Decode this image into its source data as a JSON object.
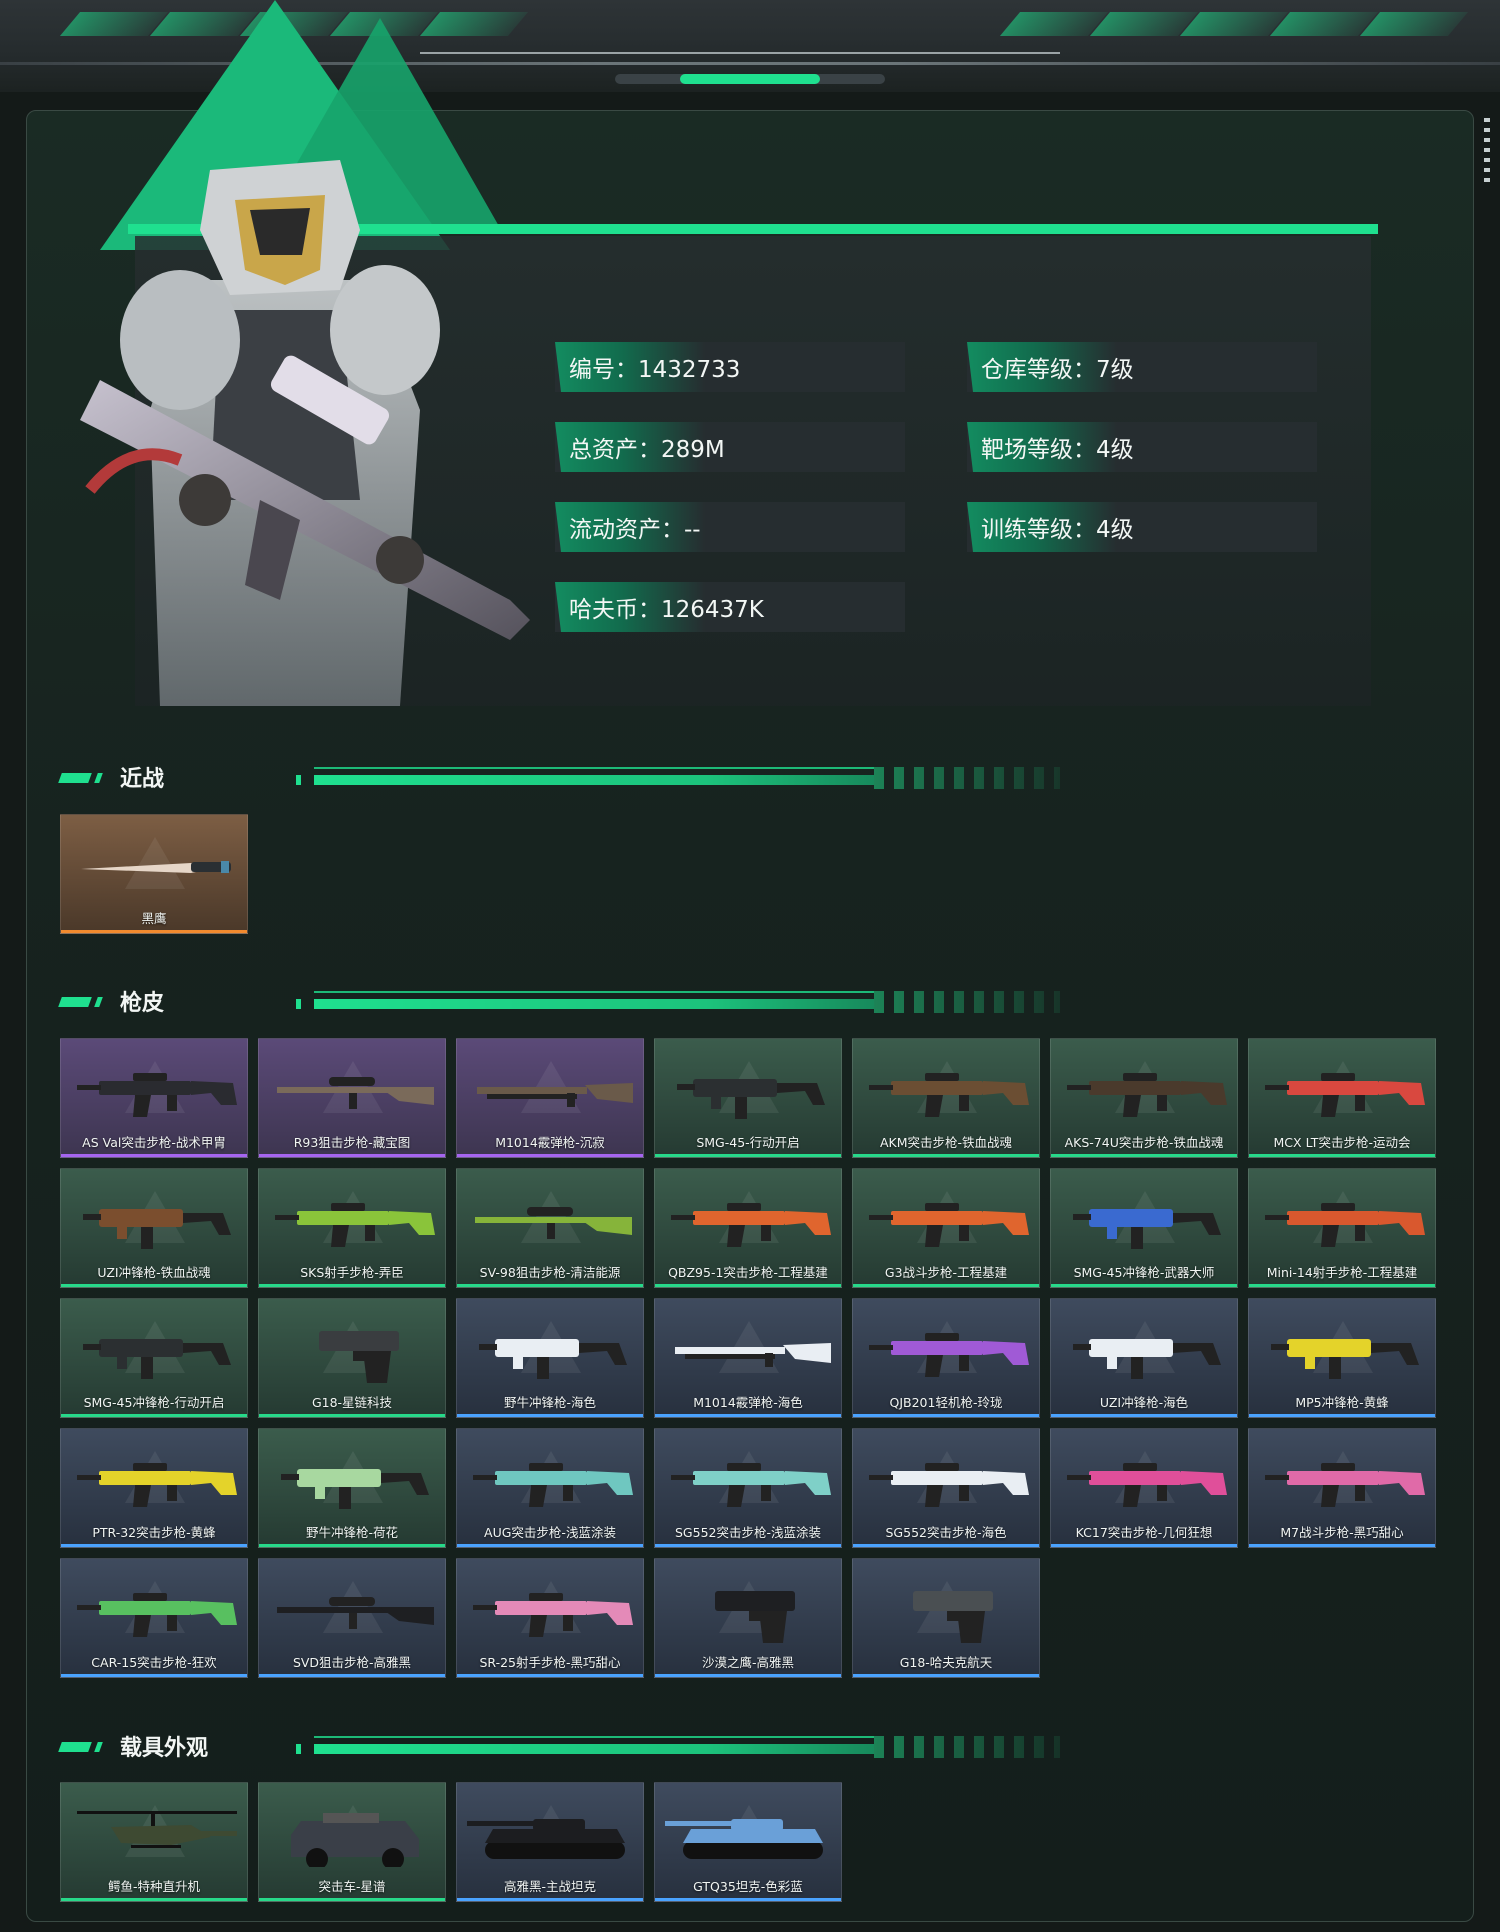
{
  "profile": {
    "stats_left": [
      "编号：1432733",
      "总资产：289M",
      "流动资产：--",
      "哈夫币：126437K"
    ],
    "stats_right": [
      "仓库等级：7级",
      "靶场等级：4级",
      "训练等级：4级"
    ]
  },
  "sections": {
    "melee": {
      "title": "近战",
      "items": [
        {
          "name": "黑鹰",
          "rarity": "orange",
          "icon": "knife-icon"
        }
      ]
    },
    "skins": {
      "title": "枪皮",
      "items": [
        {
          "name": "AS Val突击步枪-战术甲胄",
          "rarity": "purple",
          "icon": "rifle-icon",
          "color": "#2a2b30"
        },
        {
          "name": "R93狙击步枪-藏宝图",
          "rarity": "purple",
          "icon": "sniper-icon",
          "color": "#7a6a5a"
        },
        {
          "name": "M1014霰弹枪-沉寂",
          "rarity": "purple",
          "icon": "shotgun-icon",
          "color": "#6a5a4a"
        },
        {
          "name": "SMG-45-行动开启",
          "rarity": "green",
          "icon": "smg-icon",
          "color": "#2b2f31"
        },
        {
          "name": "AKM突击步枪-铁血战魂",
          "rarity": "green",
          "icon": "rifle-icon",
          "color": "#6b4e33"
        },
        {
          "name": "AKS-74U突击步枪-铁血战魂",
          "rarity": "green",
          "icon": "rifle-icon",
          "color": "#4a3a2c"
        },
        {
          "name": "MCX LT突击步枪-运动会",
          "rarity": "green",
          "icon": "rifle-icon",
          "color": "#d9483f"
        },
        {
          "name": "UZI冲锋枪-铁血战魂",
          "rarity": "green",
          "icon": "smg-icon",
          "color": "#7b4e2e"
        },
        {
          "name": "SKS射手步枪-弄臣",
          "rarity": "green",
          "icon": "rifle-icon",
          "color": "#8ac43a"
        },
        {
          "name": "SV-98狙击步枪-清洁能源",
          "rarity": "green",
          "icon": "sniper-icon",
          "color": "#86b43a"
        },
        {
          "name": "QBZ95-1突击步枪-工程基建",
          "rarity": "green",
          "icon": "rifle-icon",
          "color": "#e0652e"
        },
        {
          "name": "G3战斗步枪-工程基建",
          "rarity": "green",
          "icon": "rifle-icon",
          "color": "#e0652e"
        },
        {
          "name": "SMG-45冲锋枪-武器大师",
          "rarity": "green",
          "icon": "smg-icon",
          "color": "#3a6ad0"
        },
        {
          "name": "Mini-14射手步枪-工程基建",
          "rarity": "green",
          "icon": "rifle-icon",
          "color": "#d9582e"
        },
        {
          "name": "SMG-45冲锋枪-行动开启",
          "rarity": "green",
          "icon": "smg-icon",
          "color": "#2b2f31"
        },
        {
          "name": "G18-星链科技",
          "rarity": "green",
          "icon": "pistol-icon",
          "color": "#3a3d40"
        },
        {
          "name": "野牛冲锋枪-海色",
          "rarity": "blue",
          "icon": "smg-icon",
          "color": "#e9eef3"
        },
        {
          "name": "M1014霰弹枪-海色",
          "rarity": "blue",
          "icon": "shotgun-icon",
          "color": "#e9eef3"
        },
        {
          "name": "QJB201轻机枪-玲珑",
          "rarity": "blue",
          "icon": "rifle-icon",
          "color": "#a05ad6"
        },
        {
          "name": "UZI冲锋枪-海色",
          "rarity": "blue",
          "icon": "smg-icon",
          "color": "#e9eef3"
        },
        {
          "name": "MP5冲锋枪-黄蜂",
          "rarity": "blue",
          "icon": "smg-icon",
          "color": "#e4d32a"
        },
        {
          "name": "PTR-32突击步枪-黄蜂",
          "rarity": "blue",
          "icon": "rifle-icon",
          "color": "#e4d32a"
        },
        {
          "name": "野牛冲锋枪-荷花",
          "rarity": "green",
          "icon": "smg-icon",
          "color": "#a8d8a0"
        },
        {
          "name": "AUG突击步枪-浅蓝涂装",
          "rarity": "blue",
          "icon": "rifle-icon",
          "color": "#6fc7c0"
        },
        {
          "name": "SG552突击步枪-浅蓝涂装",
          "rarity": "blue",
          "icon": "rifle-icon",
          "color": "#7fd0c8"
        },
        {
          "name": "SG552突击步枪-海色",
          "rarity": "blue",
          "icon": "rifle-icon",
          "color": "#e9eef3"
        },
        {
          "name": "KC17突击步枪-几何狂想",
          "rarity": "blue",
          "icon": "rifle-icon",
          "color": "#e04f9a"
        },
        {
          "name": "M7战斗步枪-黑巧甜心",
          "rarity": "blue",
          "icon": "rifle-icon",
          "color": "#e06aa8"
        },
        {
          "name": "CAR-15突击步枪-狂欢",
          "rarity": "blue",
          "icon": "rifle-icon",
          "color": "#58c060"
        },
        {
          "name": "SVD狙击步枪-高雅黑",
          "rarity": "blue",
          "icon": "sniper-icon",
          "color": "#1e1f22"
        },
        {
          "name": "SR-25射手步枪-黑巧甜心",
          "rarity": "blue",
          "icon": "rifle-icon",
          "color": "#e48ab8"
        },
        {
          "name": "沙漠之鹰-高雅黑",
          "rarity": "blue",
          "icon": "pistol-icon",
          "color": "#1e1f22"
        },
        {
          "name": "G18-哈夫克航天",
          "rarity": "blue",
          "icon": "pistol-icon",
          "color": "#4a4f52"
        }
      ]
    },
    "vehicles": {
      "title": "载具外观",
      "items": [
        {
          "name": "鳄鱼-特种直升机",
          "rarity": "green",
          "icon": "helicopter-icon",
          "color": "#3e4a32"
        },
        {
          "name": "突击车-星谱",
          "rarity": "green",
          "icon": "armored-car-icon",
          "color": "#3a3f48"
        },
        {
          "name": "高雅黑-主战坦克",
          "rarity": "blue",
          "icon": "tank-icon",
          "color": "#1c1d20"
        },
        {
          "name": "GTQ35坦克-色彩蓝",
          "rarity": "blue",
          "icon": "tank-icon",
          "color": "#6aa0d8"
        }
      ]
    }
  }
}
